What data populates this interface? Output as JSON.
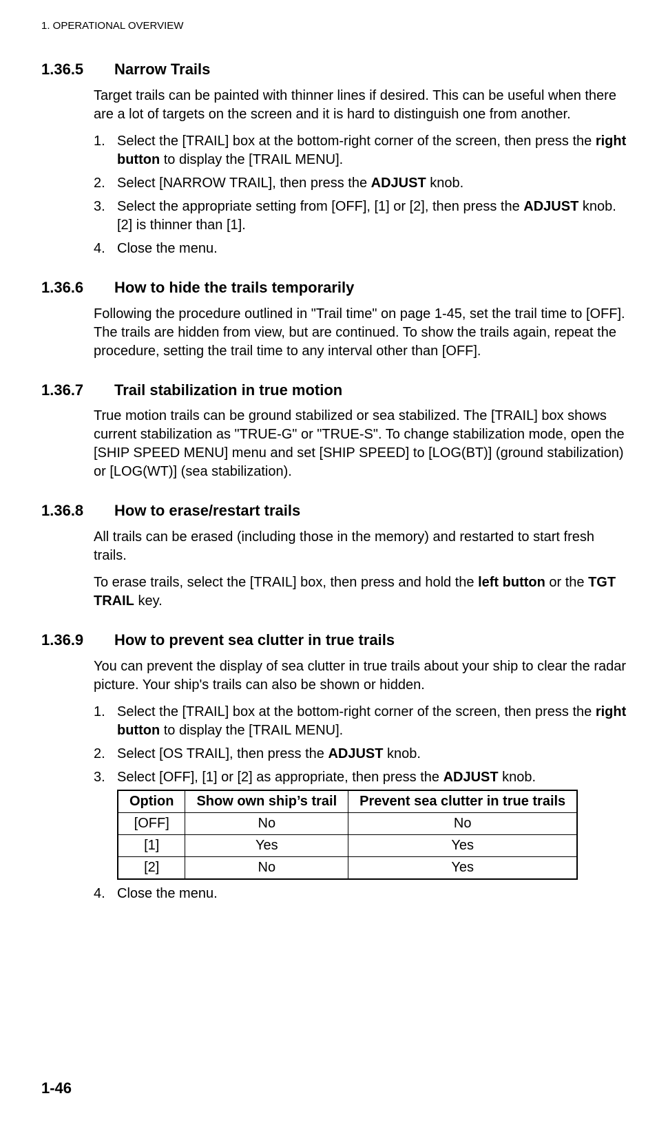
{
  "running_header": "1.  OPERATIONAL OVERVIEW",
  "page_number": "1-46",
  "sections": {
    "s1": {
      "number": "1.36.5",
      "title": "Narrow Trails",
      "intro": "Target trails can be painted with thinner lines if desired. This can be useful when there are a lot of targets on the screen and it is hard to distinguish one from another.",
      "steps": {
        "a_pre": "Select the [TRAIL] box at the bottom-right corner of the screen, then press the ",
        "a_bold": "right button",
        "a_post": " to display the [TRAIL MENU].",
        "b_pre": "Select [NARROW TRAIL], then press the ",
        "b_bold": "ADJUST",
        "b_post": " knob.",
        "c_pre": "Select the appropriate setting from [OFF], [1] or [2], then press the ",
        "c_bold": "ADJUST",
        "c_post": " knob. [2] is thinner than [1].",
        "d": "Close the menu."
      }
    },
    "s2": {
      "number": "1.36.6",
      "title": "How to hide the trails temporarily",
      "body": "Following the procedure outlined in \"Trail time\" on page 1-45, set the trail time to [OFF]. The trails are hidden from view, but are continued. To show the trails again, repeat the procedure, setting the trail time to any interval other than [OFF]."
    },
    "s3": {
      "number": "1.36.7",
      "title": "Trail stabilization in true motion",
      "body": "True motion trails can be ground stabilized or sea stabilized. The [TRAIL] box shows current stabilization as \"TRUE-G\" or \"TRUE-S\". To change stabilization mode, open the [SHIP SPEED MENU] menu and set [SHIP SPEED] to [LOG(BT)] (ground stabilization) or [LOG(WT)] (sea stabilization)."
    },
    "s4": {
      "number": "1.36.8",
      "title": "How to erase/restart trails",
      "p1": "All trails can be erased (including those in the memory) and restarted to start fresh trails.",
      "p2_pre": "To erase trails, select the [TRAIL] box, then press and hold the ",
      "p2_b1": "left button",
      "p2_mid": " or the ",
      "p2_b2": "TGT TRAIL",
      "p2_post": " key."
    },
    "s5": {
      "number": "1.36.9",
      "title": "How to prevent sea clutter in true trails",
      "intro": "You can prevent the display of sea clutter in true trails about your ship to clear the radar picture. Your ship's trails can also be shown or hidden.",
      "steps": {
        "a_pre": "Select the [TRAIL] box at the bottom-right corner of the screen, then press the ",
        "a_bold": "right button",
        "a_post": " to display the [TRAIL MENU].",
        "b_pre": "Select [OS TRAIL], then press the ",
        "b_bold": "ADJUST",
        "b_post": " knob.",
        "c_pre": "Select [OFF], [1] or [2] as appropriate, then press the ",
        "c_bold": "ADJUST",
        "c_post": " knob.",
        "d": "Close the menu."
      },
      "table": {
        "headers": {
          "h1": "Option",
          "h2": "Show own ship’s trail",
          "h3": "Prevent sea clutter in true trails"
        },
        "rows": [
          {
            "c1": "[OFF]",
            "c2": "No",
            "c3": "No"
          },
          {
            "c1": "[1]",
            "c2": "Yes",
            "c3": "Yes"
          },
          {
            "c1": "[2]",
            "c2": "No",
            "c3": "Yes"
          }
        ]
      }
    }
  }
}
